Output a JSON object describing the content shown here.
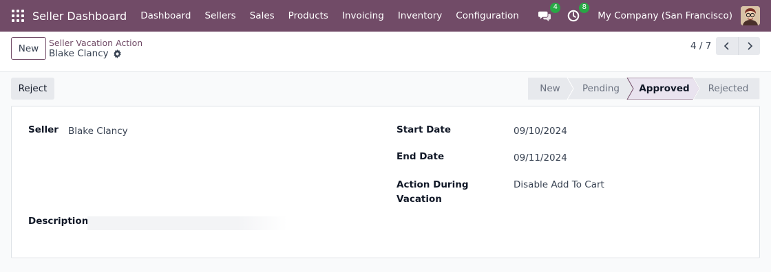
{
  "navbar": {
    "app_name": "Seller Dashboard",
    "menu": [
      "Dashboard",
      "Sellers",
      "Sales",
      "Products",
      "Invoicing",
      "Inventory",
      "Configuration"
    ],
    "messages_count": "4",
    "activities_count": "8",
    "company": "My Company (San Francisco)",
    "brand_color": "#714b67"
  },
  "control": {
    "new_label": "New",
    "breadcrumb": "Seller Vacation Action",
    "record_title": "Blake Clancy",
    "pager": "4 / 7"
  },
  "status": {
    "reject_label": "Reject",
    "stages": [
      "New",
      "Pending",
      "Approved",
      "Rejected"
    ],
    "active_stage": "Approved"
  },
  "form": {
    "seller_label": "Seller",
    "seller_value": "Blake Clancy",
    "start_date_label": "Start Date",
    "start_date_value": "09/10/2024",
    "end_date_label": "End Date",
    "end_date_value": "09/11/2024",
    "action_label_line1": "Action During",
    "action_label_line2": "Vacation",
    "action_value": "Disable Add To Cart",
    "description_label": "Description",
    "description_value": ""
  }
}
